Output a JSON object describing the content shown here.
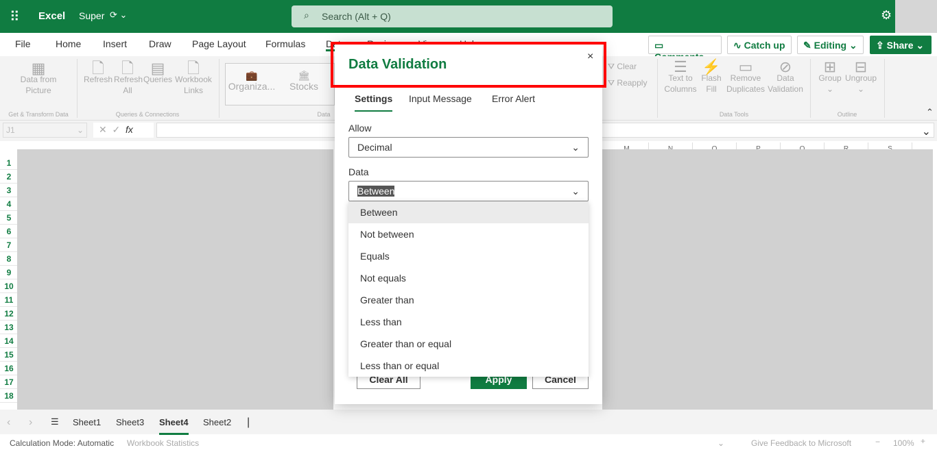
{
  "app": {
    "name": "Excel",
    "file_name": "Super",
    "search_placeholder": "Search (Alt + Q)"
  },
  "menu_tabs": [
    "File",
    "Home",
    "Insert",
    "Draw",
    "Page Layout",
    "Formulas",
    "Data",
    "Review",
    "View",
    "Help"
  ],
  "active_tab": "Data",
  "actions": {
    "comments": "Comments",
    "catch_up": "Catch up",
    "editing": "Editing",
    "share": "Share"
  },
  "ribbon": {
    "get_transform": {
      "items": [
        "Data from Picture"
      ],
      "group": "Get & Transform Data"
    },
    "queries": {
      "items": [
        "Refresh",
        "Refresh All",
        "Queries",
        "Workbook Links"
      ],
      "group": "Queries & Connections"
    },
    "data_types": {
      "items": [
        "Organiza...",
        "Stocks"
      ],
      "group": "Data"
    },
    "sort_filter": {
      "items": [
        "Clear",
        "Reapply"
      ]
    },
    "data_tools": {
      "items": [
        "Text to Columns",
        "Flash Fill",
        "Remove Duplicates",
        "Data Validation"
      ],
      "group": "Data Tools"
    },
    "outline": {
      "items": [
        "Group",
        "Ungroup"
      ],
      "group": "Outline"
    }
  },
  "formula_bar": {
    "name_box": "J1",
    "fx": "fx",
    "value": ""
  },
  "columns": [
    "M",
    "N",
    "O",
    "P",
    "Q",
    "R",
    "S"
  ],
  "rows": [
    "1",
    "2",
    "3",
    "4",
    "5",
    "6",
    "7",
    "8",
    "9",
    "10",
    "11",
    "12",
    "13",
    "14",
    "15",
    "16",
    "17",
    "18"
  ],
  "dialog": {
    "title": "Data Validation",
    "tabs": [
      "Settings",
      "Input Message",
      "Error Alert"
    ],
    "allow_label": "Allow",
    "allow_value": "Decimal",
    "data_label": "Data",
    "data_value": "Between",
    "options": [
      "Between",
      "Not between",
      "Equals",
      "Not equals",
      "Greater than",
      "Less than",
      "Greater than or equal",
      "Less than or equal"
    ],
    "clear_all": "Clear All",
    "apply": "Apply",
    "cancel": "Cancel"
  },
  "sheets": [
    "Sheet1",
    "Sheet3",
    "Sheet4",
    "Sheet2"
  ],
  "active_sheet": "Sheet4",
  "status": {
    "calc_mode": "Calculation Mode: Automatic",
    "stats": "Workbook Statistics",
    "feedback": "Give Feedback to Microsoft",
    "zoom": "100%"
  },
  "colors": {
    "brand": "#107c41",
    "highlight": "#ff0000"
  }
}
